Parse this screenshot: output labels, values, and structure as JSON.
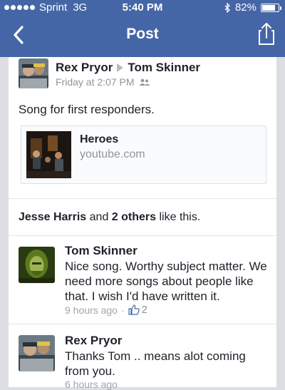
{
  "status_bar": {
    "carrier": "Sprint",
    "network": "3G",
    "time": "5:40 PM",
    "battery": "82%",
    "battery_level": 0.82
  },
  "nav": {
    "title": "Post"
  },
  "post": {
    "author": "Rex Pryor",
    "target": "Tom Skinner",
    "timestamp": "Friday at 2:07 PM",
    "text": "Song for first responders.",
    "link": {
      "title": "Heroes",
      "domain": "youtube.com"
    }
  },
  "likes": {
    "first": "Jesse Harris",
    "and": "and",
    "others": "2 others",
    "suffix": "like this."
  },
  "comments": [
    {
      "name": "Tom Skinner",
      "text": "Nice song. Worthy subject matter. We need more songs about people like that. I wish I'd have written it.",
      "time": "9 hours ago",
      "like_count": "2"
    },
    {
      "name": "Rex Pryor",
      "text": "Thanks Tom .. means alot coming from you.",
      "time": "6 hours ago"
    }
  ],
  "colors": {
    "brand": "#4566a6",
    "background": "#dcdee3"
  }
}
